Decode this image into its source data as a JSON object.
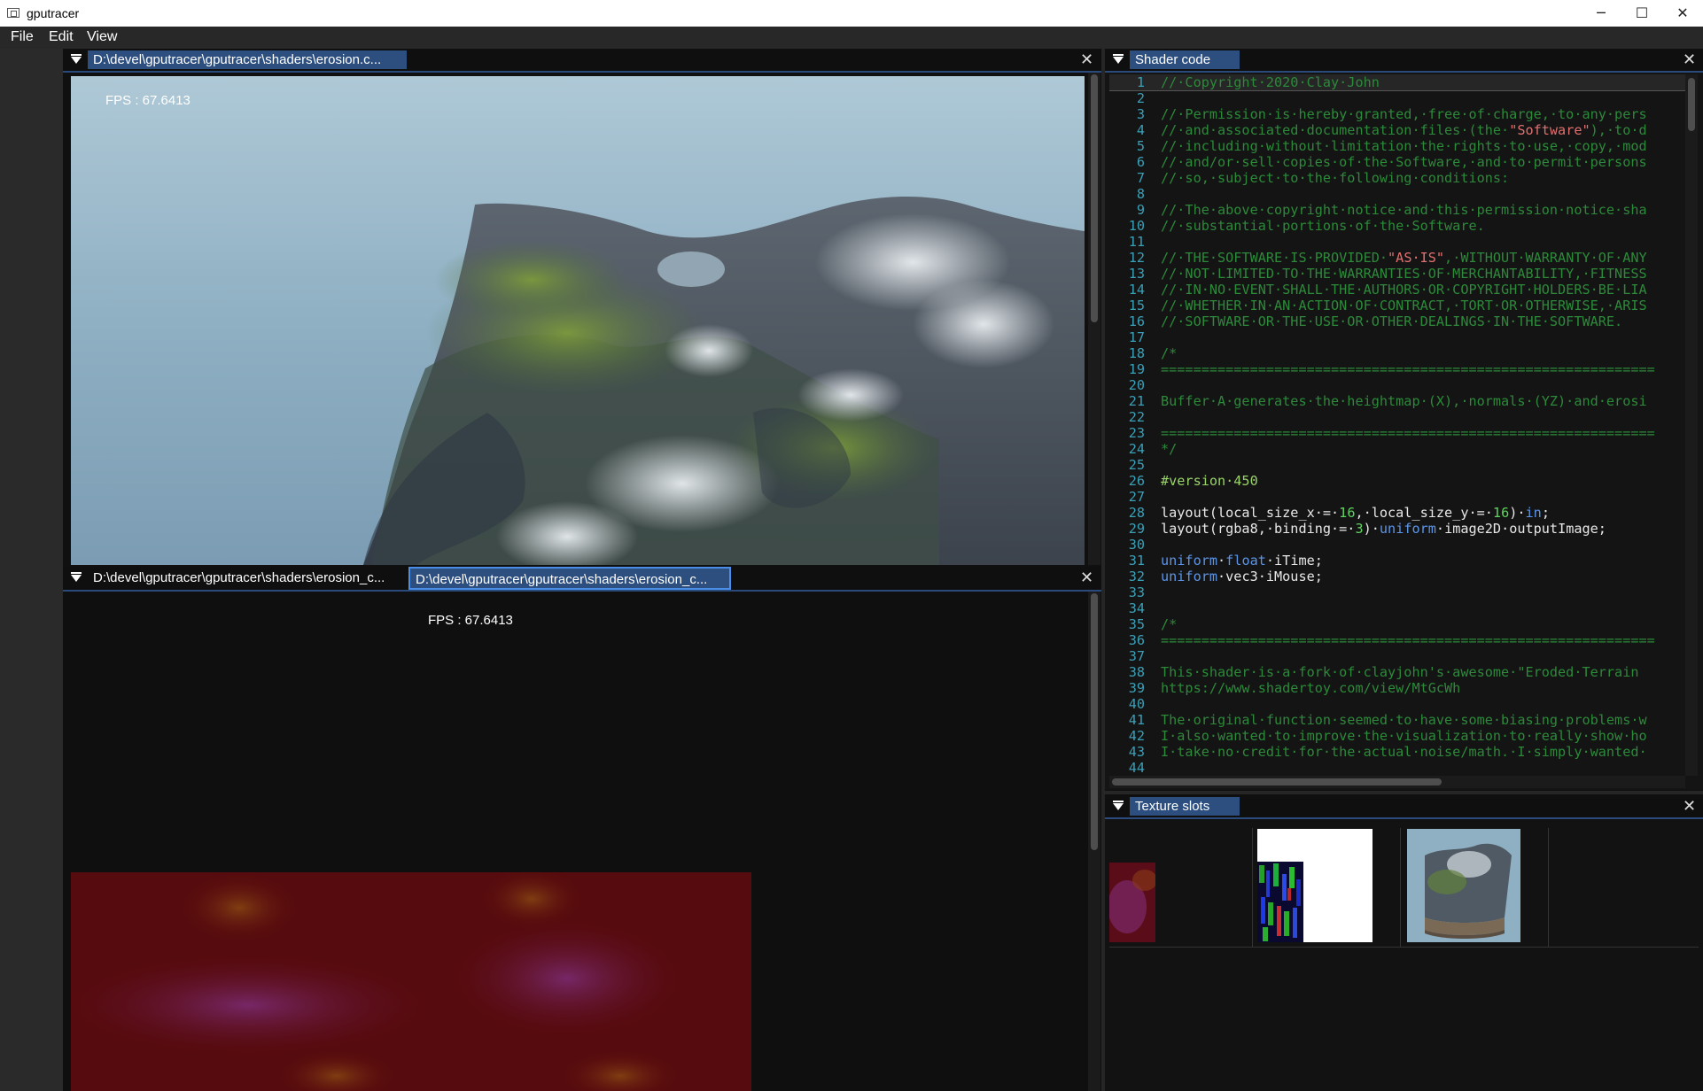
{
  "window": {
    "title": "gputracer",
    "minimize": "─",
    "maximize": "☐",
    "close": "✕"
  },
  "menu": [
    "File",
    "Edit",
    "View"
  ],
  "viewport_top": {
    "tab": "D:\\devel\\gputracer\\gputracer\\shaders\\erosion.c...",
    "fps": "FPS : 67.6413",
    "close": "✕"
  },
  "viewport_bottom": {
    "tabs": [
      "D:\\devel\\gputracer\\gputracer\\shaders\\erosion_c...",
      "D:\\devel\\gputracer\\gputracer\\shaders\\erosion_c..."
    ],
    "fps": "FPS : 67.6413",
    "close": "✕"
  },
  "shader_panel": {
    "tab": "Shader code",
    "close": "✕"
  },
  "code_lines": [
    {
      "n": "1",
      "html": "<span class=\"cm\">//·Copyright·2020·Clay·John</span>"
    },
    {
      "n": "2",
      "html": ""
    },
    {
      "n": "3",
      "html": "<span class=\"cm\">//·Permission·is·hereby·granted,·free·of·charge,·to·any·pers</span>"
    },
    {
      "n": "4",
      "html": "<span class=\"cm\">//·and·associated·documentation·files·(the·</span><span class=\"str\">\"Software\"</span><span class=\"cm\">),·to·d</span>"
    },
    {
      "n": "5",
      "html": "<span class=\"cm\">//·including·without·limitation·the·rights·to·use,·copy,·mod</span>"
    },
    {
      "n": "6",
      "html": "<span class=\"cm\">//·and/or·sell·copies·of·the·Software,·and·to·permit·persons</span>"
    },
    {
      "n": "7",
      "html": "<span class=\"cm\">//·so,·subject·to·the·following·conditions:</span>"
    },
    {
      "n": "8",
      "html": ""
    },
    {
      "n": "9",
      "html": "<span class=\"cm\">//·The·above·copyright·notice·and·this·permission·notice·sha</span>"
    },
    {
      "n": "10",
      "html": "<span class=\"cm\">//·substantial·portions·of·the·Software.</span>"
    },
    {
      "n": "11",
      "html": ""
    },
    {
      "n": "12",
      "html": "<span class=\"cm\">//·THE·SOFTWARE·IS·PROVIDED·</span><span class=\"str\">\"AS·IS\"</span><span class=\"cm\">,·WITHOUT·WARRANTY·OF·ANY</span>"
    },
    {
      "n": "13",
      "html": "<span class=\"cm\">//·NOT·LIMITED·TO·THE·WARRANTIES·OF·MERCHANTABILITY,·FITNESS</span>"
    },
    {
      "n": "14",
      "html": "<span class=\"cm\">//·IN·NO·EVENT·SHALL·THE·AUTHORS·OR·COPYRIGHT·HOLDERS·BE·LIA</span>"
    },
    {
      "n": "15",
      "html": "<span class=\"cm\">//·WHETHER·IN·AN·ACTION·OF·CONTRACT,·TORT·OR·OTHERWISE,·ARIS</span>"
    },
    {
      "n": "16",
      "html": "<span class=\"cm\">//·SOFTWARE·OR·THE·USE·OR·OTHER·DEALINGS·IN·THE·SOFTWARE.</span>"
    },
    {
      "n": "17",
      "html": ""
    },
    {
      "n": "18",
      "html": "<span class=\"cm\">/*</span>"
    },
    {
      "n": "19",
      "html": "<span class=\"cm\">=============================================================</span>"
    },
    {
      "n": "20",
      "html": ""
    },
    {
      "n": "21",
      "html": "<span class=\"cm\">Buffer·A·generates·the·heightmap·(X),·normals·(YZ)·and·erosi</span>"
    },
    {
      "n": "22",
      "html": ""
    },
    {
      "n": "23",
      "html": "<span class=\"cm\">=============================================================</span>"
    },
    {
      "n": "24",
      "html": "<span class=\"cm\">*/</span>"
    },
    {
      "n": "25",
      "html": ""
    },
    {
      "n": "26",
      "html": "<span class=\"pp\">#version·450</span>"
    },
    {
      "n": "27",
      "html": ""
    },
    {
      "n": "28",
      "html": "layout(local_size_x·=·<span class=\"num\">16</span>,·local_size_y·=·<span class=\"num\">16</span>)·<span class=\"kw\">in</span>;"
    },
    {
      "n": "29",
      "html": "layout(rgba8,·binding·=·<span class=\"num\">3</span>)·<span class=\"kw\">uniform</span>·image2D·outputImage;"
    },
    {
      "n": "30",
      "html": ""
    },
    {
      "n": "31",
      "html": "<span class=\"kw\">uniform</span>·<span class=\"kw\">float</span>·iTime;"
    },
    {
      "n": "32",
      "html": "<span class=\"kw\">uniform</span>·vec3·iMouse;"
    },
    {
      "n": "33",
      "html": ""
    },
    {
      "n": "34",
      "html": ""
    },
    {
      "n": "35",
      "html": "<span class=\"cm\">/*</span>"
    },
    {
      "n": "36",
      "html": "<span class=\"cm\">=============================================================</span>"
    },
    {
      "n": "37",
      "html": ""
    },
    {
      "n": "38",
      "html": "<span class=\"cm\">This·shader·is·a·fork·of·clayjohn's·awesome·\"Eroded·Terrain</span>"
    },
    {
      "n": "39",
      "html": "<span class=\"cm\">https://www.shadertoy.com/view/MtGcWh</span>"
    },
    {
      "n": "40",
      "html": ""
    },
    {
      "n": "41",
      "html": "<span class=\"cm\">The·original·function·seemed·to·have·some·biasing·problems·w</span>"
    },
    {
      "n": "42",
      "html": "<span class=\"cm\">I·also·wanted·to·improve·the·visualization·to·really·show·ho</span>"
    },
    {
      "n": "43",
      "html": "<span class=\"cm\">I·take·no·credit·for·the·actual·noise/math.·I·simply·wanted·</span>"
    },
    {
      "n": "44",
      "html": ""
    }
  ],
  "texture_panel": {
    "tab": "Texture slots",
    "close": "✕"
  },
  "colors": {
    "accent": "#2c4f80",
    "focus": "#4a8ee8",
    "comment": "#2c8a3a",
    "string": "#e07070",
    "keyword": "#5c95e8",
    "number": "#5fd35f",
    "line_number": "#3aa0b8"
  }
}
